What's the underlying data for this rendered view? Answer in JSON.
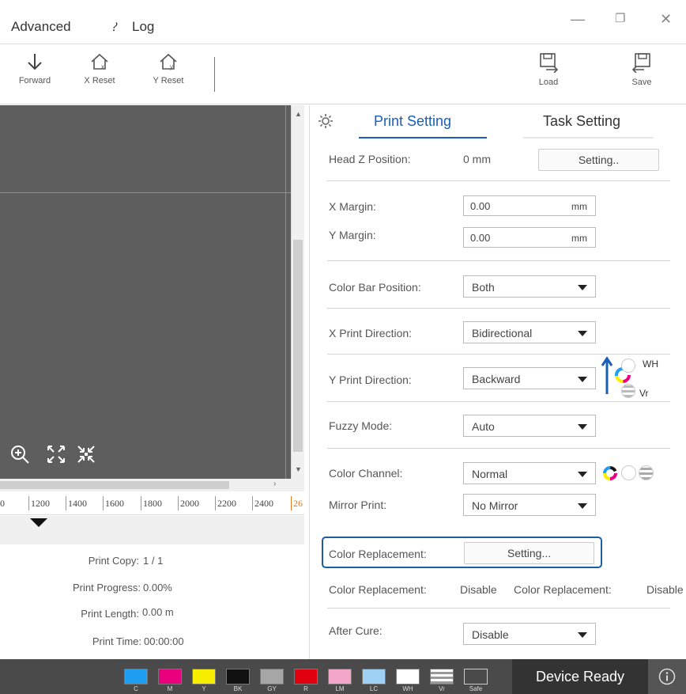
{
  "menu": {
    "advanced": "Advanced",
    "log": "Log"
  },
  "toolbar": {
    "forward": "Forward",
    "x_reset": "X Reset",
    "y_reset": "Y Reset",
    "load": "Load",
    "save": "Save"
  },
  "ruler": {
    "ticks": [
      "0",
      "1200",
      "1400",
      "1600",
      "1800",
      "2000",
      "2200",
      "2400",
      "26"
    ]
  },
  "stats": {
    "print_copy_label": "Print Copy:",
    "print_copy_value": "1 / 1",
    "print_progress_label": "Print Progress:",
    "print_progress_value": "0.00%",
    "print_length_label": "Print Length:",
    "print_length_value": "0.00 m",
    "print_time_label": "Print Time:",
    "print_time_value": "00:00:00"
  },
  "panel": {
    "tab_print": "Print Setting",
    "tab_task": "Task Setting",
    "head_z_label": "Head Z Position:",
    "head_z_value": "0 mm",
    "setting_btn": "Setting..",
    "x_margin_label": "X Margin:",
    "x_margin_value": "0.00",
    "y_margin_label": "Y Margin:",
    "y_margin_value": "0.00",
    "unit_mm": "mm",
    "color_bar_label": "Color Bar Position:",
    "color_bar_value": "Both",
    "x_dir_label": "X Print Direction:",
    "x_dir_value": "Bidirectional",
    "y_dir_label": "Y Print Direction:",
    "y_dir_value": "Backward",
    "wh_label": "WH",
    "vr_label": "Vr",
    "fuzzy_label": "Fuzzy Mode:",
    "fuzzy_value": "Auto",
    "channel_label": "Color Channel:",
    "channel_value": "Normal",
    "mirror_label": "Mirror Print:",
    "mirror_value": "No Mirror",
    "color_repl_label": "Color Replacement:",
    "color_repl_btn": "Setting...",
    "color_repl_status_label": "Color Replacement:",
    "color_repl_status_value": "Disable",
    "color_repl_status_label2": "Color Replacement:",
    "color_repl_status_value2": "Disable",
    "after_cure_label": "After Cure:",
    "after_cure_value": "Disable"
  },
  "status": {
    "inks": [
      {
        "label": "C",
        "color": "#1e9ff2"
      },
      {
        "label": "M",
        "color": "#e8007d"
      },
      {
        "label": "Y",
        "color": "#f7ee00"
      },
      {
        "label": "BK",
        "color": "#111111"
      },
      {
        "label": "GY",
        "color": "#a6a6a6"
      },
      {
        "label": "R",
        "color": "#e00010"
      },
      {
        "label": "LM",
        "color": "#f4a6c8"
      },
      {
        "label": "LC",
        "color": "#9fd1f5"
      },
      {
        "label": "WH",
        "color": "#ffffff"
      },
      {
        "label": "Vr",
        "color": "#ffffff"
      },
      {
        "label": "Safe",
        "color": "#4a4a4a"
      }
    ],
    "device_ready": "Device Ready"
  }
}
